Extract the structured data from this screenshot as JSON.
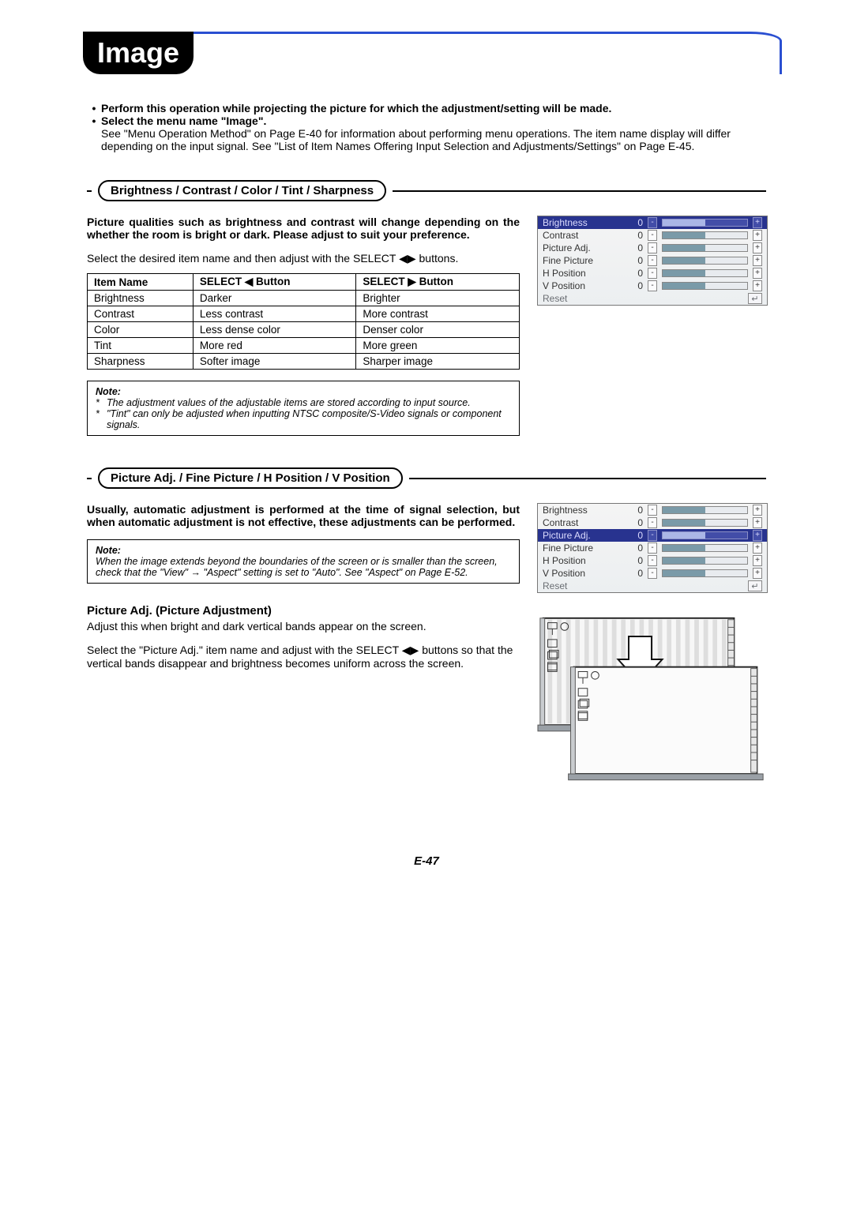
{
  "page_title": "Image",
  "intro": {
    "b1": "Perform this operation while projecting the picture for which the adjustment/setting will be made.",
    "b2": "Select the menu name \"Image\".",
    "b2_sub": "See \"Menu Operation Method\" on Page E-40 for information about performing menu operations. The item name display will differ depending on the input signal. See \"List of Item Names Offering Input Selection and Adjustments/Settings\" on Page E-45."
  },
  "section1": {
    "heading": "Brightness / Contrast / Color / Tint / Sharpness",
    "lead": "Picture qualities such as brightness and contrast will change depending on the whether the room is bright or dark. Please adjust to suit your preference.",
    "instr_a": "Select the desired item name and then adjust with the SELECT ",
    "instr_b": " buttons.",
    "table": {
      "h1": "Item Name",
      "h2a": "SELECT ",
      "h2b": " Button",
      "h3a": "SELECT ",
      "h3b": " Button",
      "rows": [
        {
          "n": "Brightness",
          "l": "Darker",
          "r": "Brighter"
        },
        {
          "n": "Contrast",
          "l": "Less contrast",
          "r": "More contrast"
        },
        {
          "n": "Color",
          "l": "Less dense color",
          "r": "Denser color"
        },
        {
          "n": "Tint",
          "l": "More red",
          "r": "More green"
        },
        {
          "n": "Sharpness",
          "l": "Softer image",
          "r": "Sharper image"
        }
      ]
    },
    "note_title": "Note:",
    "notes": [
      "The adjustment values of the adjustable items are stored according to input source.",
      "\"Tint\" can only be adjusted when inputting NTSC composite/S-Video signals or component signals."
    ],
    "osd": {
      "items": [
        {
          "label": "Brightness",
          "value": "0",
          "sel": true
        },
        {
          "label": "Contrast",
          "value": "0"
        },
        {
          "label": "Picture Adj.",
          "value": "0"
        },
        {
          "label": "Fine Picture",
          "value": "0"
        },
        {
          "label": "H Position",
          "value": "0"
        },
        {
          "label": "V Position",
          "value": "0"
        }
      ],
      "reset": "Reset"
    }
  },
  "section2": {
    "heading": "Picture Adj. / Fine Picture / H Position / V Position",
    "lead": "Usually, automatic adjustment is performed at the time of signal selection, but when automatic adjustment is not effective, these adjustments can be performed.",
    "note_title": "Note:",
    "note_a": "When the image extends beyond the boundaries of the screen or is smaller than the screen, check that the \"View\" ",
    "note_arrow": "→",
    "note_b": " \"Aspect\" setting is set to \"Auto\". See \"Aspect\" on Page E-52.",
    "osd": {
      "items": [
        {
          "label": "Brightness",
          "value": "0"
        },
        {
          "label": "Contrast",
          "value": "0"
        },
        {
          "label": "Picture Adj.",
          "value": "0",
          "sel": true
        },
        {
          "label": "Fine Picture",
          "value": "0"
        },
        {
          "label": "H Position",
          "value": "0"
        },
        {
          "label": "V Position",
          "value": "0"
        }
      ],
      "reset": "Reset"
    }
  },
  "section3": {
    "heading": "Picture Adj. (Picture Adjustment)",
    "p1": "Adjust this when bright and dark vertical bands appear on the screen.",
    "p2a": "Select the \"Picture Adj.\" item name and adjust with the SELECT ",
    "p2b": " buttons so that the vertical bands disappear and brightness becomes uniform across the screen."
  },
  "glyphs": {
    "left": "◀",
    "right": "▶",
    "lr": "◀▶",
    "return": "↵"
  },
  "pageno": "E-47"
}
